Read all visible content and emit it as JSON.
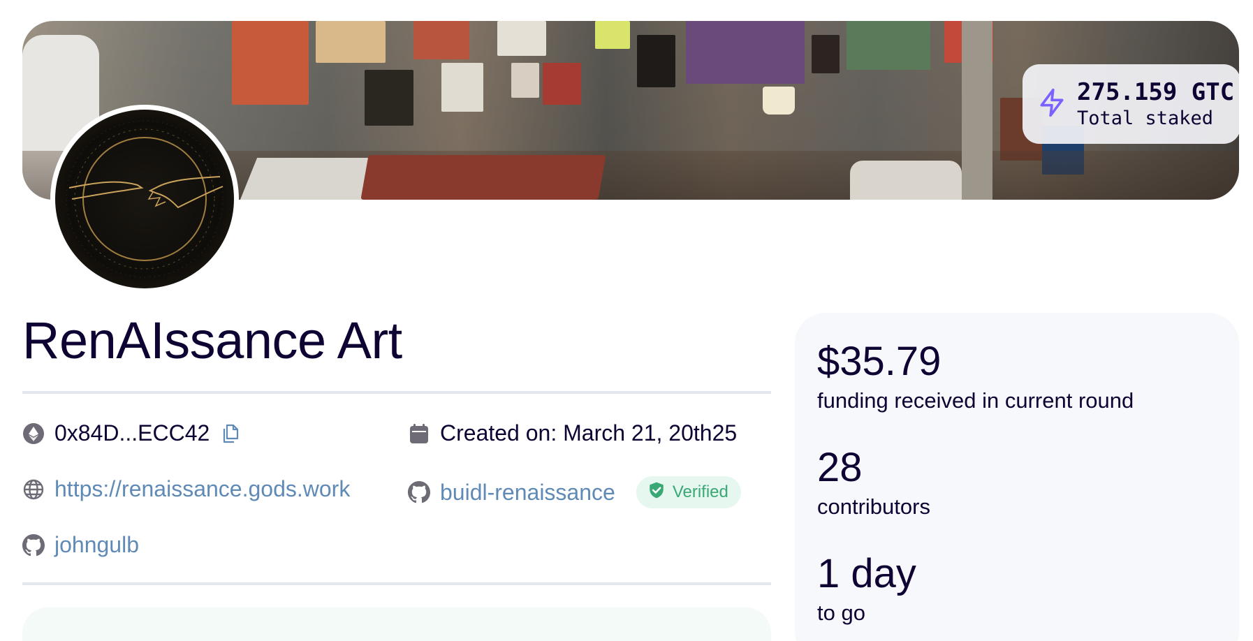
{
  "banner": {
    "total_staked_amount": "275.159 GTC",
    "total_staked_label": "Total staked",
    "icon": "lightning-bolt-icon"
  },
  "project": {
    "name": "RenAIssance Art",
    "wallet_address": "0x84D...ECC42",
    "created_on": "Created on: March 21, 20th25",
    "website": "https://renaissance.gods.work",
    "project_github": "buidl-renaissance",
    "verified_label": "Verified",
    "user_github": "johngulb"
  },
  "stats": {
    "funding_amount": "$35.79",
    "funding_label": "funding received in current round",
    "contributors_count": "28",
    "contributors_label": "contributors",
    "time_left": "1 day",
    "time_left_label": "to go"
  },
  "colors": {
    "text": "#0e0333",
    "link": "#5f8ab6",
    "verified_bg": "#e6f7ef",
    "verified_text": "#3aa875",
    "stake_icon": "#7b61ff"
  }
}
